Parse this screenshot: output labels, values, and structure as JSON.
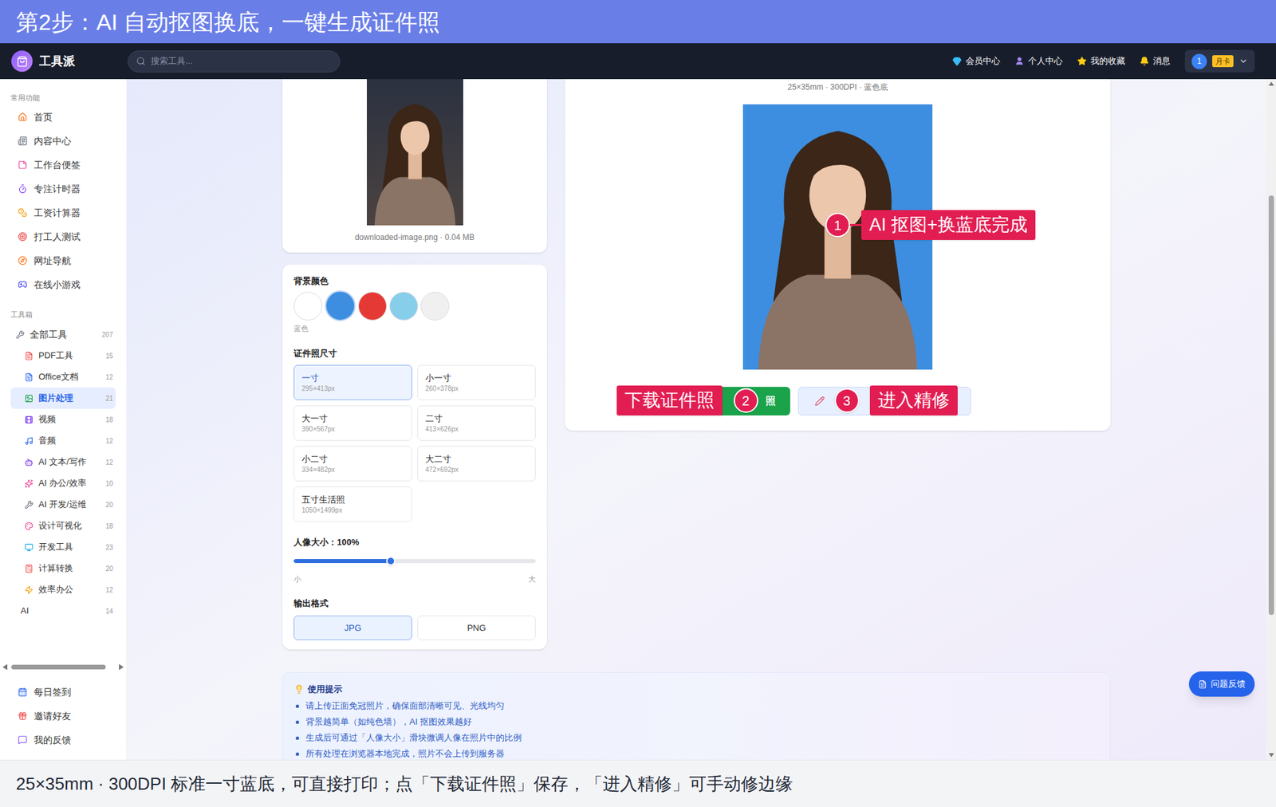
{
  "banner": {
    "title": "第2步：AI 自动抠图换底，一键生成证件照"
  },
  "header": {
    "logo": "工具派",
    "search_placeholder": "搜索工具...",
    "nav": [
      "会员中心",
      "个人中心",
      "我的收藏",
      "消息"
    ],
    "user": {
      "avatar": "1",
      "badge": "月卡"
    }
  },
  "sidebar": {
    "sections": [
      {
        "title": "常用功能",
        "items": [
          {
            "label": "首页",
            "selected": false,
            "kind": "item"
          },
          {
            "label": "内容中心",
            "selected": false,
            "kind": "item"
          },
          {
            "label": "工作台便签",
            "selected": false,
            "kind": "item"
          },
          {
            "label": "专注计时器",
            "selected": false,
            "kind": "item"
          },
          {
            "label": "工资计算器",
            "selected": false,
            "kind": "item"
          },
          {
            "label": "打工人测试",
            "selected": false,
            "kind": "item"
          },
          {
            "label": "网址导航",
            "selected": false,
            "kind": "item"
          },
          {
            "label": "在线小游戏",
            "selected": false,
            "kind": "item"
          }
        ]
      },
      {
        "title": "工具箱",
        "items": [
          {
            "label": "全部工具",
            "count": "207",
            "selected": false,
            "kind": "group"
          },
          {
            "label": "PDF工具",
            "count": "15",
            "selected": false,
            "kind": "sub"
          },
          {
            "label": "Office文档",
            "count": "12",
            "selected": false,
            "kind": "sub"
          },
          {
            "label": "图片处理",
            "count": "21",
            "selected": true,
            "kind": "sub"
          },
          {
            "label": "视频",
            "count": "18",
            "selected": false,
            "kind": "sub"
          },
          {
            "label": "音频",
            "count": "12",
            "selected": false,
            "kind": "sub"
          },
          {
            "label": "AI 文本/写作",
            "count": "12",
            "selected": false,
            "kind": "sub"
          },
          {
            "label": "AI 办公/效率",
            "count": "10",
            "selected": false,
            "kind": "sub"
          },
          {
            "label": "AI 开发/运维",
            "count": "20",
            "selected": false,
            "kind": "sub"
          },
          {
            "label": "设计可视化",
            "count": "18",
            "selected": false,
            "kind": "sub"
          },
          {
            "label": "开发工具",
            "count": "23",
            "selected": false,
            "kind": "sub"
          },
          {
            "label": "计算转换",
            "count": "20",
            "selected": false,
            "kind": "sub"
          },
          {
            "label": "效率办公",
            "count": "12",
            "selected": false,
            "kind": "sub"
          },
          {
            "label": "AI",
            "count": "14",
            "selected": false,
            "kind": "plain"
          }
        ]
      }
    ],
    "footer_items": [
      "每日签到",
      "邀请好友",
      "我的反馈"
    ]
  },
  "upload": {
    "file": "downloaded-image.png · 0.04 MB"
  },
  "settings": {
    "background": {
      "title": "背景颜色",
      "caption": "蓝色",
      "colors": [
        {
          "color": "#ffffff",
          "selected": false
        },
        {
          "color": "#3d8ee0",
          "selected": true
        },
        {
          "color": "#e53935",
          "selected": false
        },
        {
          "color": "#87ceeb",
          "selected": false
        },
        {
          "color": "#f0f0f0",
          "selected": false
        }
      ]
    },
    "sizes": {
      "title": "证件照尺寸",
      "items": [
        {
          "name": "一寸",
          "pixels": "295×413px",
          "selected": true
        },
        {
          "name": "小一寸",
          "pixels": "260×378px",
          "selected": false
        },
        {
          "name": "大一寸",
          "pixels": "390×567px",
          "selected": false
        },
        {
          "name": "二寸",
          "pixels": "413×626px",
          "selected": false
        },
        {
          "name": "小二寸",
          "pixels": "334×482px",
          "selected": false
        },
        {
          "name": "大二寸",
          "pixels": "472×692px",
          "selected": false
        },
        {
          "name": "五寸生活照",
          "pixels": "1050×1499px",
          "selected": false
        }
      ]
    },
    "portrait": {
      "label": "人像大小：100%",
      "level": 0.4,
      "min": "小",
      "max": "大"
    },
    "format": {
      "title": "输出格式",
      "options": [
        {
          "label": "JPG",
          "selected": true
        },
        {
          "label": "PNG",
          "selected": false
        }
      ]
    }
  },
  "preview": {
    "spec": "25×35mm · 300DPI · 蓝色底",
    "buttons": [
      {
        "kind": "download",
        "label": "照"
      },
      {
        "kind": "edit"
      }
    ]
  },
  "annotations": [
    {
      "number": "1",
      "label": "AI 抠图+换蓝底完成"
    },
    {
      "number": "2",
      "label": "下载证件照"
    },
    {
      "number": "3",
      "label": "进入精修"
    }
  ],
  "tips": {
    "title": "使用提示",
    "items": [
      "请上传正面免冠照片，确保面部清晰可见、光线均匀",
      "背景越简单（如纯色墙），AI 抠图效果越好",
      "生成后可通过「人像大小」滑块微调人像在照片中的比例",
      "所有处理在浏览器本地完成，照片不会上传到服务器"
    ]
  },
  "feedback": "问题反馈",
  "caption": "25×35mm · 300DPI 标准一寸蓝底，可直接打印；点「下载证件照」保存，「进入精修」可手动修边缘"
}
